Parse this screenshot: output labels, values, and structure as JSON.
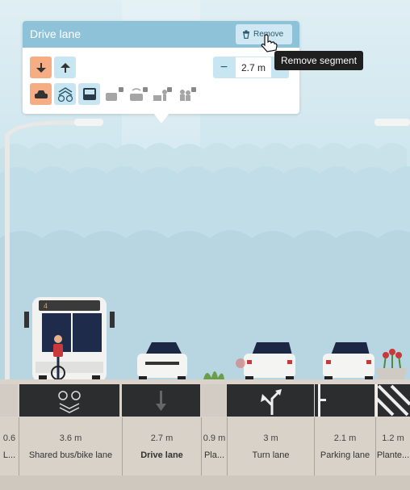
{
  "popup": {
    "title": "Drive lane",
    "remove_label": "Remove",
    "tooltip": "Remove segment",
    "width_value": "2.7 m",
    "minus_label": "−",
    "direction_buttons": [
      "inbound-arrow-icon",
      "outbound-arrow-icon"
    ],
    "variant_buttons": [
      "car-icon",
      "sharrow-bike-icon",
      "bus-icon",
      "autonomous-vehicle-locked-icon",
      "connected-car-locked-icon",
      "pickup-dropoff-locked-icon",
      "rideshare-locked-icon"
    ]
  },
  "segments": [
    {
      "width": "0.6",
      "name": "L..."
    },
    {
      "width": "3.6 m",
      "name": "Shared bus/bike lane"
    },
    {
      "width": "2.7 m",
      "name": "Drive lane"
    },
    {
      "width": "0.9 m",
      "name": "Pla..."
    },
    {
      "width": "3 m",
      "name": "Turn lane"
    },
    {
      "width": "2.1 m",
      "name": "Parking lane"
    },
    {
      "width": "1.2 m",
      "name": "Plante..."
    }
  ],
  "vehicles": {
    "bus_route_number": "4"
  },
  "colors": {
    "popup_header": "#8ec2d8",
    "selected_direction": "#f6ad84",
    "button_bg": "#c8e6f2",
    "asphalt": "#2b2d2e",
    "tooltip_bg": "#1f1f1f"
  }
}
